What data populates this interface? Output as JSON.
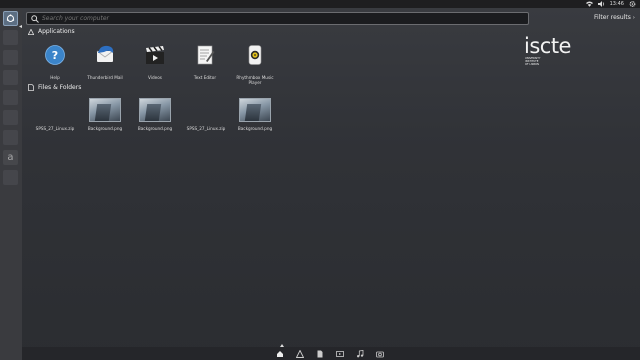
{
  "top_panel": {
    "clock": "13:46"
  },
  "search": {
    "placeholder": "Search your computer",
    "value": ""
  },
  "filter_results": "Filter results",
  "sections": {
    "applications": "Applications",
    "files_folders": "Files & Folders"
  },
  "apps": [
    {
      "label": "Help",
      "icon": "help-icon"
    },
    {
      "label": "Thunderbird Mail",
      "icon": "thunderbird-icon"
    },
    {
      "label": "Videos",
      "icon": "videos-icon"
    },
    {
      "label": "Text Editor",
      "icon": "text-editor-icon"
    },
    {
      "label": "Rhythmbox Music Player",
      "icon": "rhythmbox-icon"
    }
  ],
  "files": [
    {
      "label": "SPSS_27_Linux.zip",
      "thumbnail": false
    },
    {
      "label": "Background.png",
      "thumbnail": true
    },
    {
      "label": "Background.png",
      "thumbnail": true
    },
    {
      "label": "SPSS_27_Linux.zip",
      "thumbnail": false
    },
    {
      "label": "Background.png",
      "thumbnail": true
    }
  ],
  "logo": {
    "name": "iscte",
    "subtitle_lines": [
      "UNIVERSITY",
      "INSTITUTE",
      "OF LISBON"
    ]
  },
  "lenses": [
    "home-lens-icon",
    "applications-lens-icon",
    "files-lens-icon",
    "video-lens-icon",
    "music-lens-icon",
    "photos-lens-icon"
  ],
  "colors": {
    "accent": "#5c6e82",
    "help_blue": "#3b84c9"
  }
}
